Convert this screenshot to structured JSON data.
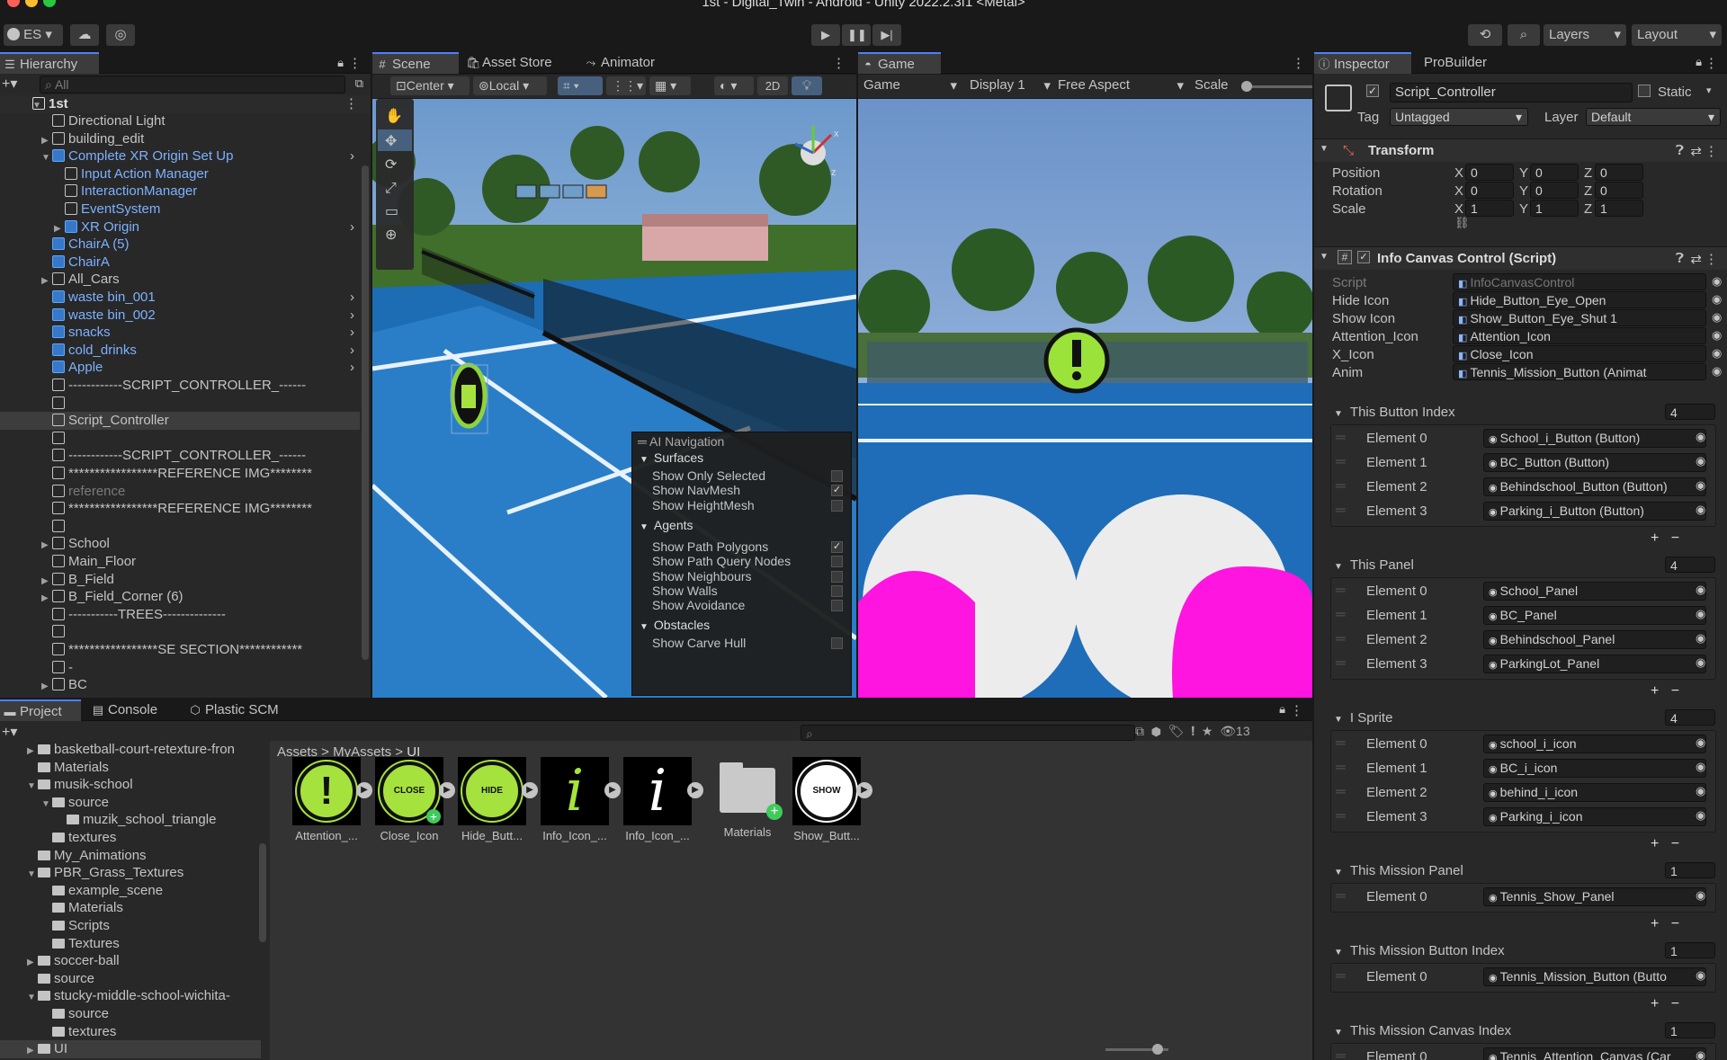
{
  "window_title": "1st - Digital_Twin - Android - Unity 2022.2.3f1 <Metal>",
  "toolbar": {
    "account": "ES",
    "layers": "Layers",
    "layout": "Layout"
  },
  "hierarchy": {
    "tab": "Hierarchy",
    "search_placeholder": "All",
    "scene": "1st",
    "items": [
      {
        "label": "Directional Light",
        "indent": 1,
        "type": "go",
        "arrow": ""
      },
      {
        "label": "building_edit",
        "indent": 1,
        "type": "go",
        "arrow": "▶"
      },
      {
        "label": "Complete XR Origin Set Up",
        "indent": 1,
        "type": "prefab",
        "arrow": "▼"
      },
      {
        "label": "Input Action Manager",
        "indent": 2,
        "type": "go-blue",
        "arrow": ""
      },
      {
        "label": "InteractionManager",
        "indent": 2,
        "type": "go-blue",
        "arrow": ""
      },
      {
        "label": "EventSystem",
        "indent": 2,
        "type": "go-blue",
        "arrow": ""
      },
      {
        "label": "XR Origin",
        "indent": 2,
        "type": "prefab",
        "arrow": "▶"
      },
      {
        "label": "ChairA (5)",
        "indent": 1,
        "type": "prefab",
        "arrow": ""
      },
      {
        "label": "ChairA",
        "indent": 1,
        "type": "prefab",
        "arrow": ""
      },
      {
        "label": "All_Cars",
        "indent": 1,
        "type": "go",
        "arrow": "▶"
      },
      {
        "label": "waste bin_001",
        "indent": 1,
        "type": "prefab",
        "arrow": ""
      },
      {
        "label": "waste bin_002",
        "indent": 1,
        "type": "prefab",
        "arrow": ""
      },
      {
        "label": "snacks",
        "indent": 1,
        "type": "prefab",
        "arrow": ""
      },
      {
        "label": "cold_drinks",
        "indent": 1,
        "type": "prefab",
        "arrow": ""
      },
      {
        "label": "Apple",
        "indent": 1,
        "type": "prefab",
        "arrow": ""
      },
      {
        "label": "------------SCRIPT_CONTROLLER_------",
        "indent": 1,
        "type": "go",
        "arrow": ""
      },
      {
        "label": "",
        "indent": 1,
        "type": "go",
        "arrow": ""
      },
      {
        "label": "Script_Controller",
        "indent": 1,
        "type": "go",
        "arrow": ""
      },
      {
        "label": "",
        "indent": 1,
        "type": "go",
        "arrow": ""
      },
      {
        "label": "------------SCRIPT_CONTROLLER_------",
        "indent": 1,
        "type": "go",
        "arrow": ""
      },
      {
        "label": "*****************REFERENCE IMG********",
        "indent": 1,
        "type": "go",
        "arrow": ""
      },
      {
        "label": "reference",
        "indent": 1,
        "type": "go-dim",
        "arrow": ""
      },
      {
        "label": "*****************REFERENCE IMG********",
        "indent": 1,
        "type": "go",
        "arrow": ""
      },
      {
        "label": "",
        "indent": 1,
        "type": "go",
        "arrow": ""
      },
      {
        "label": "School",
        "indent": 1,
        "type": "go",
        "arrow": "▶"
      },
      {
        "label": "Main_Floor",
        "indent": 1,
        "type": "go",
        "arrow": ""
      },
      {
        "label": "B_Field",
        "indent": 1,
        "type": "go",
        "arrow": "▶"
      },
      {
        "label": "B_Field_Corner (6)",
        "indent": 1,
        "type": "go",
        "arrow": "▶"
      },
      {
        "label": "-----------TREES--------------",
        "indent": 1,
        "type": "go",
        "arrow": ""
      },
      {
        "label": "",
        "indent": 1,
        "type": "go",
        "arrow": ""
      },
      {
        "label": "*****************SE SECTION************",
        "indent": 1,
        "type": "go",
        "arrow": ""
      },
      {
        "label": "-",
        "indent": 1,
        "type": "go",
        "arrow": ""
      },
      {
        "label": "BC",
        "indent": 1,
        "type": "go",
        "arrow": "▶"
      }
    ]
  },
  "scene_view": {
    "tabs": [
      "Scene",
      "Asset Store",
      "Animator"
    ],
    "pivot": "Center",
    "space": "Local",
    "mode_2d": "2D",
    "overlay": {
      "title": "AI Navigation",
      "sections": [
        {
          "header": "Surfaces",
          "items": [
            {
              "label": "Show Only Selected",
              "checked": false
            },
            {
              "label": "Show NavMesh",
              "checked": true
            },
            {
              "label": "Show HeightMesh",
              "checked": false
            }
          ]
        },
        {
          "header": "Agents",
          "items": [
            {
              "label": "Show Path Polygons",
              "checked": true
            },
            {
              "label": "Show Path Query Nodes",
              "checked": false
            },
            {
              "label": "Show Neighbours",
              "checked": false
            },
            {
              "label": "Show Walls",
              "checked": false
            },
            {
              "label": "Show Avoidance",
              "checked": false
            }
          ]
        },
        {
          "header": "Obstacles",
          "items": [
            {
              "label": "Show Carve Hull",
              "checked": false
            }
          ]
        }
      ]
    }
  },
  "game_view": {
    "tab": "Game",
    "mode": "Game",
    "display": "Display 1",
    "aspect": "Free Aspect",
    "scale_label": "Scale"
  },
  "project": {
    "tabs": [
      "Project",
      "Console",
      "Plastic SCM"
    ],
    "hidden_count": "13",
    "breadcrumb": [
      "Assets",
      "MyAssets",
      "UI"
    ],
    "tree": [
      {
        "label": "basketball-court-retexture-fron",
        "indent": 1,
        "arrow": "▶"
      },
      {
        "label": "Materials",
        "indent": 1,
        "arrow": ""
      },
      {
        "label": "musik-school",
        "indent": 1,
        "arrow": "▼"
      },
      {
        "label": "source",
        "indent": 2,
        "arrow": "▼"
      },
      {
        "label": "muzik_school_triangle",
        "indent": 3,
        "arrow": ""
      },
      {
        "label": "textures",
        "indent": 2,
        "arrow": ""
      },
      {
        "label": "My_Animations",
        "indent": 1,
        "arrow": ""
      },
      {
        "label": "PBR_Grass_Textures",
        "indent": 1,
        "arrow": "▼"
      },
      {
        "label": "example_scene",
        "indent": 2,
        "arrow": ""
      },
      {
        "label": "Materials",
        "indent": 2,
        "arrow": ""
      },
      {
        "label": "Scripts",
        "indent": 2,
        "arrow": ""
      },
      {
        "label": "Textures",
        "indent": 2,
        "arrow": ""
      },
      {
        "label": "soccer-ball",
        "indent": 1,
        "arrow": "▶"
      },
      {
        "label": "source",
        "indent": 1,
        "arrow": ""
      },
      {
        "label": "stucky-middle-school-wichita-",
        "indent": 1,
        "arrow": "▼"
      },
      {
        "label": "source",
        "indent": 2,
        "arrow": ""
      },
      {
        "label": "textures",
        "indent": 2,
        "arrow": ""
      },
      {
        "label": "UI",
        "indent": 1,
        "arrow": "▶"
      }
    ],
    "assets": [
      {
        "name": "Attention_...",
        "icon": "attention-icon",
        "glyph": "!"
      },
      {
        "name": "Close_Icon",
        "icon": "close-icon",
        "glyph": "CLOSE"
      },
      {
        "name": "Hide_Butt...",
        "icon": "hide-eye-icon",
        "glyph": "HIDE"
      },
      {
        "name": "Info_Icon_...",
        "icon": "info-icon",
        "glyph": "i"
      },
      {
        "name": "Info_Icon_...",
        "icon": "info-icon",
        "glyph": "i"
      },
      {
        "name": "Materials",
        "icon": "folder-icon",
        "glyph": ""
      },
      {
        "name": "Show_Butt...",
        "icon": "show-eye-icon",
        "glyph": "SHOW"
      }
    ]
  },
  "inspector": {
    "tabs": [
      "Inspector",
      "ProBuilder"
    ],
    "object_name": "Script_Controller",
    "static_label": "Static",
    "tag_label": "Tag",
    "tag": "Untagged",
    "layer_label": "Layer",
    "layer": "Default",
    "transform": {
      "title": "Transform",
      "rows": [
        {
          "label": "Position",
          "x": "0",
          "y": "0",
          "z": "0"
        },
        {
          "label": "Rotation",
          "x": "0",
          "y": "0",
          "z": "0"
        },
        {
          "label": "Scale",
          "x": "1",
          "y": "1",
          "z": "1"
        }
      ]
    },
    "component": {
      "title": "Info Canvas Control (Script)",
      "fields": [
        {
          "label": "Script",
          "value": "InfoCanvasControl",
          "dim": true
        },
        {
          "label": "Hide Icon",
          "value": "Hide_Button_Eye_Open"
        },
        {
          "label": "Show Icon",
          "value": "Show_Button_Eye_Shut 1"
        },
        {
          "label": "Attention_Icon",
          "value": "Attention_Icon"
        },
        {
          "label": "X_Icon",
          "value": "Close_Icon"
        },
        {
          "label": "Anim",
          "value": "Tennis_Mission_Button (Animat"
        }
      ],
      "lists": [
        {
          "label": "This Button Index",
          "count": "4",
          "elements": [
            "School_i_Button (Button)",
            "BC_Button (Button)",
            "Behindschool_Button (Button)",
            "Parking_i_Button (Button)"
          ]
        },
        {
          "label": "This Panel",
          "count": "4",
          "elements": [
            "School_Panel",
            "BC_Panel",
            "Behindschool_Panel",
            "ParkingLot_Panel"
          ]
        },
        {
          "label": "I Sprite",
          "count": "4",
          "elements": [
            "school_i_icon",
            "BC_i_icon",
            "behind_i_icon",
            "Parking_i_icon"
          ]
        },
        {
          "label": "This Mission Panel",
          "count": "1",
          "elements": [
            "Tennis_Show_Panel"
          ]
        },
        {
          "label": "This Mission Button Index",
          "count": "1",
          "elements": [
            "Tennis_Mission_Button (Butto"
          ]
        },
        {
          "label": "This Mission Canvas Index",
          "count": "1",
          "elements": [
            "Tennis_Attention_Canvas (Car"
          ]
        }
      ],
      "element_prefix": "Element"
    }
  }
}
